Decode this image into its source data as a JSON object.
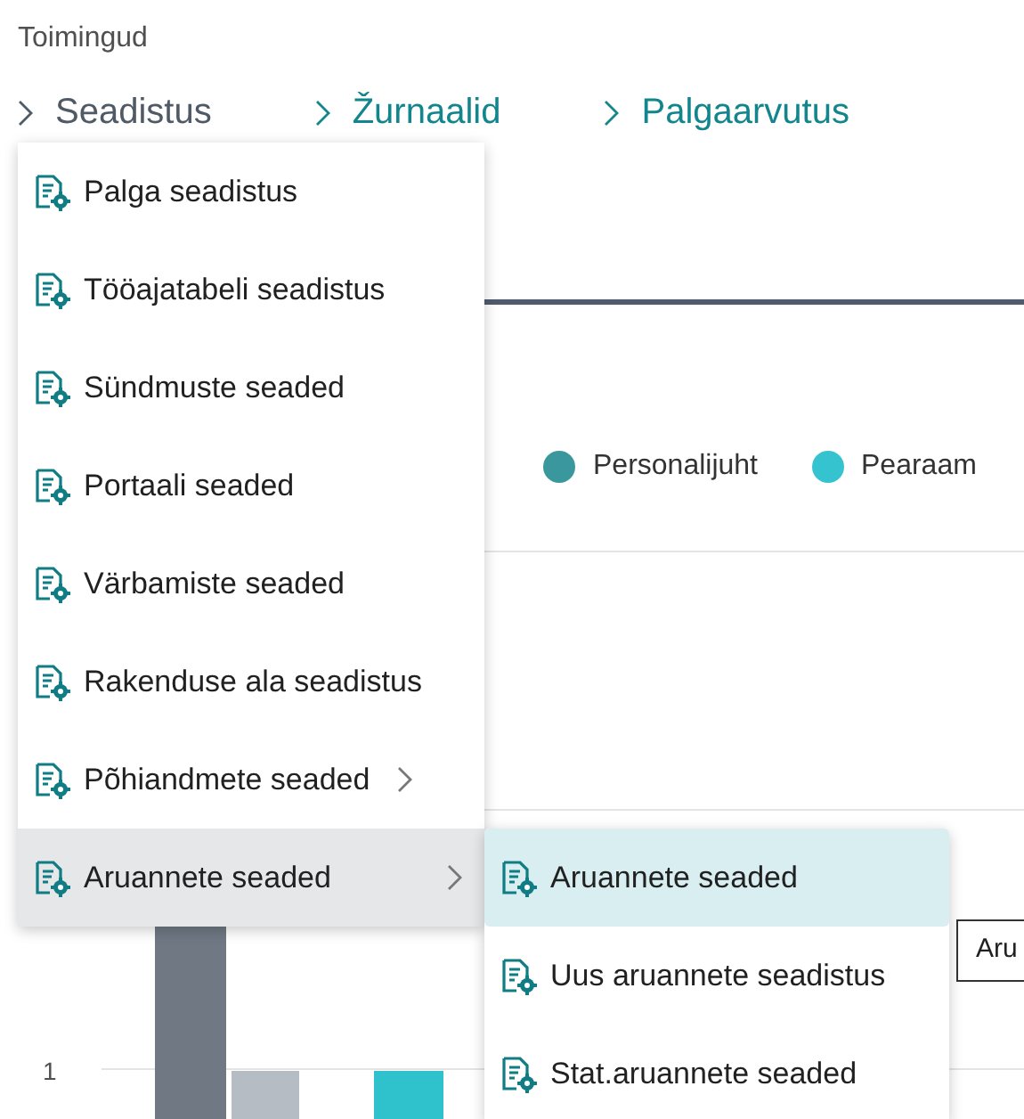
{
  "section_title": "Toimingud",
  "actions": [
    {
      "label": "Seadistus",
      "expanded": true
    },
    {
      "label": "Žurnaalid",
      "expanded": false
    },
    {
      "label": "Palgaarvutus",
      "expanded": false
    }
  ],
  "legend": [
    {
      "label": "Personalijuht",
      "color": "#3a979d"
    },
    {
      "label": "Pearaam",
      "color": "#35c4cf"
    }
  ],
  "chart_tick": "1",
  "tooltip": "Aru",
  "menu": [
    {
      "label": "Palga seadistus",
      "selected": false,
      "has_submenu": false
    },
    {
      "label": "Tööajatabeli seadistus",
      "selected": false,
      "has_submenu": false
    },
    {
      "label": "Sündmuste seaded",
      "selected": false,
      "has_submenu": false
    },
    {
      "label": "Portaali seaded",
      "selected": false,
      "has_submenu": false
    },
    {
      "label": "Värbamiste seaded",
      "selected": false,
      "has_submenu": false
    },
    {
      "label": "Rakenduse ala seadistus",
      "selected": false,
      "has_submenu": false
    },
    {
      "label": "Põhiandmete seaded",
      "selected": false,
      "has_submenu": true
    },
    {
      "label": "Aruannete seaded",
      "selected": true,
      "has_submenu": true
    }
  ],
  "submenu": [
    {
      "label": "Aruannete seaded",
      "selected": true
    },
    {
      "label": "Uus aruannete seadistus",
      "selected": false
    },
    {
      "label": "Stat.aruannete seaded",
      "selected": false
    }
  ]
}
